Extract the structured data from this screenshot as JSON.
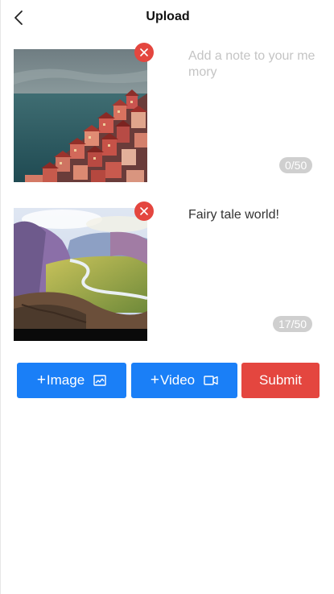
{
  "header": {
    "title": "Upload",
    "back_icon": "chevron-left-icon"
  },
  "items": [
    {
      "image": "coastal-town-painting",
      "note": "",
      "placeholder": "Add a note to your memory",
      "counter": "0/50",
      "remove_icon": "close-icon"
    },
    {
      "image": "fairy-tale-valley-painting",
      "note": "Fairy tale world!",
      "placeholder": "Add a note to your memory",
      "counter": "17/50",
      "remove_icon": "close-icon"
    }
  ],
  "actions": {
    "add_image_prefix": "+",
    "add_image_label": "Image",
    "add_video_prefix": "+",
    "add_video_label": "Video",
    "submit_label": "Submit"
  },
  "colors": {
    "primary": "#1a7ff7",
    "danger": "#e4463f",
    "counter_bg": "#cfcfcf",
    "placeholder": "#c4c4c4"
  }
}
